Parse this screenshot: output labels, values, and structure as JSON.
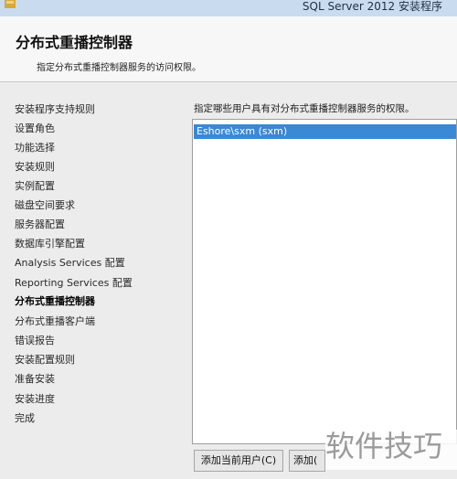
{
  "window": {
    "title": "SQL Server 2012 安装程序",
    "icon": "sql-server-setup-icon"
  },
  "header": {
    "title": "分布式重播控制器",
    "description": "指定分布式重播控制器服务的访问权限。"
  },
  "sidebar": {
    "items": [
      {
        "label": "安装程序支持规则",
        "active": false
      },
      {
        "label": "设置角色",
        "active": false
      },
      {
        "label": "功能选择",
        "active": false
      },
      {
        "label": "安装规则",
        "active": false
      },
      {
        "label": "实例配置",
        "active": false
      },
      {
        "label": "磁盘空间要求",
        "active": false
      },
      {
        "label": "服务器配置",
        "active": false
      },
      {
        "label": "数据库引擎配置",
        "active": false
      },
      {
        "label": "Analysis Services 配置",
        "active": false
      },
      {
        "label": "Reporting Services 配置",
        "active": false
      },
      {
        "label": "分布式重播控制器",
        "active": true
      },
      {
        "label": "分布式重播客户端",
        "active": false
      },
      {
        "label": "错误报告",
        "active": false
      },
      {
        "label": "安装配置规则",
        "active": false
      },
      {
        "label": "准备安装",
        "active": false
      },
      {
        "label": "安装进度",
        "active": false
      },
      {
        "label": "完成",
        "active": false
      }
    ]
  },
  "main": {
    "prompt": "指定哪些用户具有对分布式重播控制器服务的权限。",
    "users": [
      "Eshore\\sxm (sxm)"
    ],
    "buttons": {
      "add_current_user": "添加当前用户(C)",
      "add": "添加("
    }
  },
  "watermark": "软件技巧",
  "colors": {
    "titlebar": "#c9dcef",
    "selection": "#3b88d4"
  }
}
